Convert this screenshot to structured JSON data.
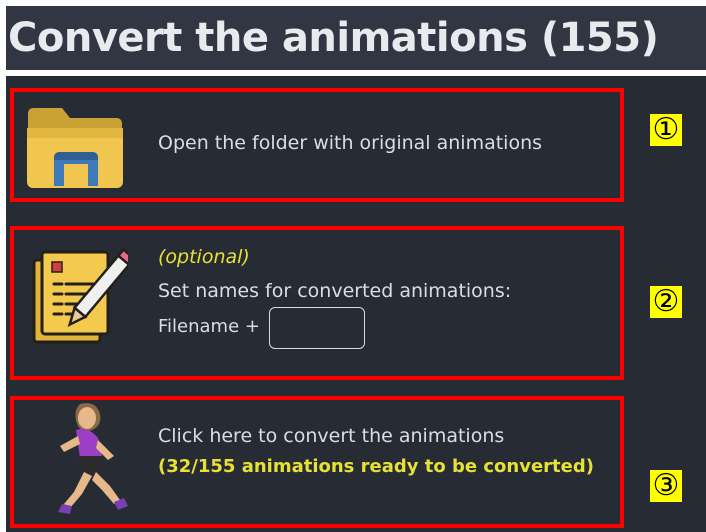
{
  "header": {
    "title": "Convert the animations (155)"
  },
  "steps": {
    "open_folder": {
      "label": "Open the folder with original animations",
      "icon": "folder-icon",
      "badge": "①"
    },
    "names": {
      "optional_label": "(optional)",
      "label": "Set names for converted animations:",
      "filename_label": "Filename +",
      "filename_value": "",
      "icon": "notepad-pencil-icon",
      "badge": "②"
    },
    "convert": {
      "label": "Click here to convert the animations",
      "status": "(32/155 animations ready to be converted)",
      "icon": "running-woman-icon",
      "badge": "③"
    }
  },
  "colors": {
    "highlight_border": "#ff0000",
    "accent_text": "#e7e035",
    "badge_bg": "#ffff00",
    "panel_bg": "#272b34"
  }
}
